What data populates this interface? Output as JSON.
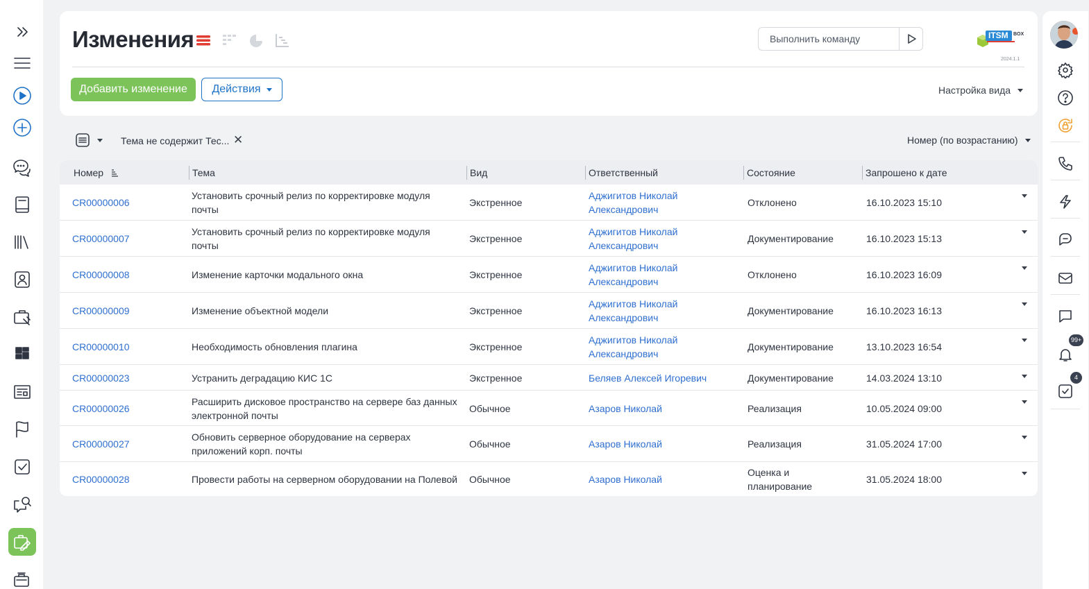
{
  "page": {
    "title": "Изменения",
    "command_placeholder": "Выполнить команду",
    "version": "2024.1.1",
    "logo_text": "ITSM",
    "logo_sub": "BOX"
  },
  "toolbar": {
    "add_label": "Добавить изменение",
    "actions_label": "Действия",
    "view_settings_label": "Настройка вида"
  },
  "filter": {
    "chip_label": "Тема не содержит Тес...",
    "sort_label": "Номер (по возрастанию)"
  },
  "table": {
    "columns": [
      "Номер",
      "Тема",
      "Вид",
      "Ответственный",
      "Состояние",
      "Запрошено к дате"
    ],
    "rows": [
      {
        "id": "CR00000006",
        "subject": [
          "Установить срочный релиз по корректировке модуля",
          "почты"
        ],
        "type": "Экстренное",
        "owner": [
          "Аджигитов Николай",
          "Александрович"
        ],
        "status": [
          "Отклонено"
        ],
        "date": "16.10.2023 15:10"
      },
      {
        "id": "CR00000007",
        "subject": [
          "Установить срочный релиз по корректировке модуля",
          "почты"
        ],
        "type": "Экстренное",
        "owner": [
          "Аджигитов Николай",
          "Александрович"
        ],
        "status": [
          "Документирование"
        ],
        "date": "16.10.2023 15:13"
      },
      {
        "id": "CR00000008",
        "subject": [
          "Изменение карточки модального окна"
        ],
        "type": "Экстренное",
        "owner": [
          "Аджигитов Николай",
          "Александрович"
        ],
        "status": [
          "Отклонено"
        ],
        "date": "16.10.2023 16:09"
      },
      {
        "id": "CR00000009",
        "subject": [
          "Изменение объектной модели"
        ],
        "type": "Экстренное",
        "owner": [
          "Аджигитов Николай",
          "Александрович"
        ],
        "status": [
          "Документирование"
        ],
        "date": "16.10.2023 16:13"
      },
      {
        "id": "CR00000010",
        "subject": [
          "Необходимость обновления плагина"
        ],
        "type": "Экстренное",
        "owner": [
          "Аджигитов Николай",
          "Александрович"
        ],
        "status": [
          "Документирование"
        ],
        "date": "13.10.2023 16:54"
      },
      {
        "id": "CR00000023",
        "subject": [
          "Устранить деградацию КИС 1С"
        ],
        "type": "Экстренное",
        "owner": [
          "Беляев Алексей Игоревич"
        ],
        "status": [
          "Документирование"
        ],
        "date": "14.03.2024 13:10"
      },
      {
        "id": "CR00000026",
        "subject": [
          "Расширить дисковое пространство на сервере баз данных",
          "электронной почты"
        ],
        "type": "Обычное",
        "owner": [
          "Азаров Николай"
        ],
        "status": [
          "Реализация"
        ],
        "date": "10.05.2024 09:00"
      },
      {
        "id": "CR00000027",
        "subject": [
          "Обновить серверное оборудование на серверах",
          "приложений корп. почты"
        ],
        "type": "Обычное",
        "owner": [
          "Азаров Николай"
        ],
        "status": [
          "Реализация"
        ],
        "date": "31.05.2024 17:00"
      },
      {
        "id": "CR00000028",
        "subject": [
          "Провести работы на серверном оборудовании на Полевой"
        ],
        "type": "Обычное",
        "owner": [
          "Азаров Николай"
        ],
        "status": [
          "Оценка и",
          "планирование"
        ],
        "date": "31.05.2024 18:00"
      }
    ]
  },
  "right_sidebar": {
    "notifications_badge": "99+",
    "tasks_badge": "4"
  },
  "colors": {
    "accent_green": "#7cc35a",
    "link_blue": "#2f6fd0",
    "primary_blue": "#1e73c7",
    "active_view_red": "#e03c31"
  }
}
